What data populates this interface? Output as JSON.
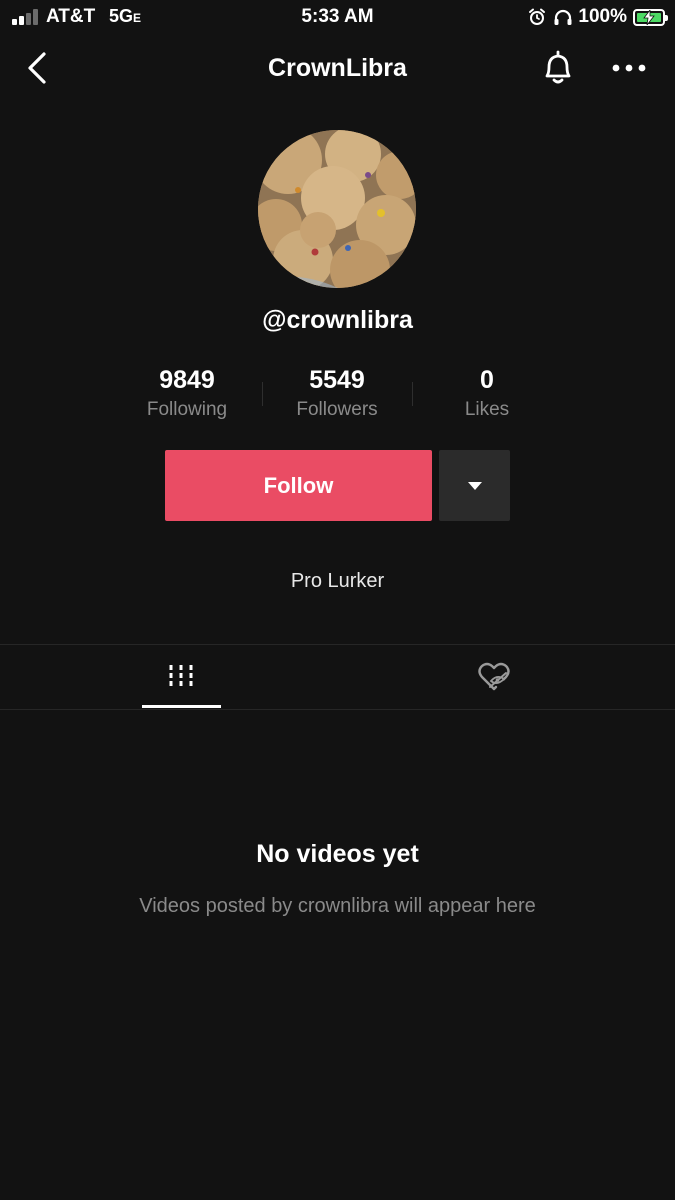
{
  "status_bar": {
    "carrier": "AT&T",
    "network": "5G",
    "network_suffix": "E",
    "time": "5:33 AM",
    "battery_percent": "100%",
    "battery_color": "#4cd964",
    "signal_bars_active": 2,
    "icons": [
      "alarm-icon",
      "headphones-icon",
      "battery-charging-icon"
    ]
  },
  "header": {
    "title": "CrownLibra",
    "icons": [
      "back-arrow-icon",
      "bell-icon",
      "more-icon"
    ]
  },
  "profile": {
    "handle": "@crownlibra",
    "avatar": "cookies-photo",
    "bio": "Pro Lurker"
  },
  "stats": [
    {
      "count": "9849",
      "label": "Following"
    },
    {
      "count": "5549",
      "label": "Followers"
    },
    {
      "count": "0",
      "label": "Likes"
    }
  ],
  "actions": {
    "follow_label": "Follow",
    "follow_color": "#ea4c64",
    "dropdown_icon": "caret-down-icon"
  },
  "tabs": [
    {
      "name": "videos",
      "icon": "grid-icon",
      "active": true
    },
    {
      "name": "liked",
      "icon": "private-heart-icon",
      "active": false
    }
  ],
  "empty_state": {
    "title": "No videos yet",
    "subtitle": "Videos posted by crownlibra will appear here"
  }
}
